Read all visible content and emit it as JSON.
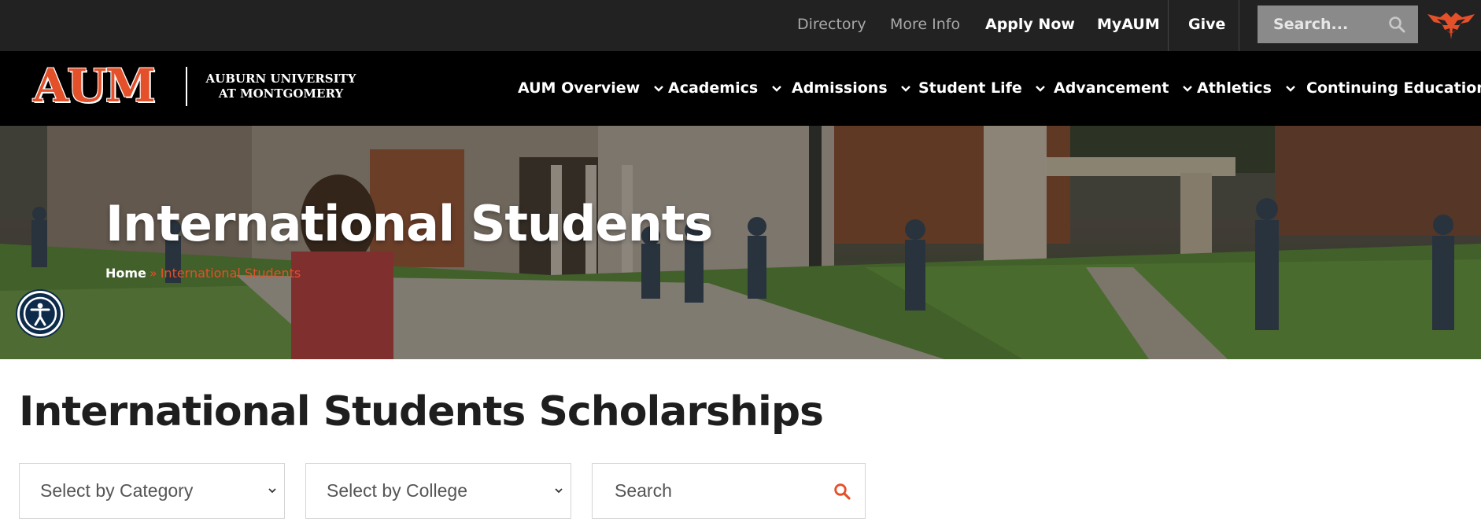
{
  "utility_bar": {
    "links": [
      {
        "id": "directory",
        "label": "Directory"
      },
      {
        "id": "more-info",
        "label": "More Info"
      },
      {
        "id": "apply-now",
        "label": "Apply Now"
      },
      {
        "id": "myaum",
        "label": "MyAUM"
      },
      {
        "id": "give",
        "label": "Give"
      }
    ],
    "search": {
      "placeholder": "Search...",
      "icon": "search-icon"
    },
    "mascot_icon": "warhawk-bird-icon"
  },
  "logo": {
    "mark": "AUM",
    "line1": "AUBURN UNIVERSITY",
    "line2": "AT MONTGOMERY"
  },
  "main_nav": {
    "items": [
      {
        "label": "AUM Overview",
        "has_dropdown": true
      },
      {
        "label": "Academics",
        "has_dropdown": true
      },
      {
        "label": "Admissions",
        "has_dropdown": true
      },
      {
        "label": "Student Life",
        "has_dropdown": true
      },
      {
        "label": "Advancement",
        "has_dropdown": true
      },
      {
        "label": "Athletics",
        "has_dropdown": true
      },
      {
        "label": "Continuing Education",
        "has_dropdown": false
      }
    ]
  },
  "hero": {
    "title": "International Students",
    "breadcrumb": {
      "home": "Home",
      "separator": "»",
      "current": "International Students"
    },
    "accessibility_icon": "accessibility-icon"
  },
  "content": {
    "heading": "International Students Scholarships",
    "filters": {
      "category": {
        "selected": "Select by Category"
      },
      "college": {
        "selected": "Select by College"
      },
      "search": {
        "placeholder": "Search",
        "icon": "search-icon"
      }
    }
  },
  "colors": {
    "brand_orange": "#e4502a",
    "utility_bg": "#222222",
    "nav_bg": "#000000",
    "accessibility_blue": "#0d2b4a"
  }
}
